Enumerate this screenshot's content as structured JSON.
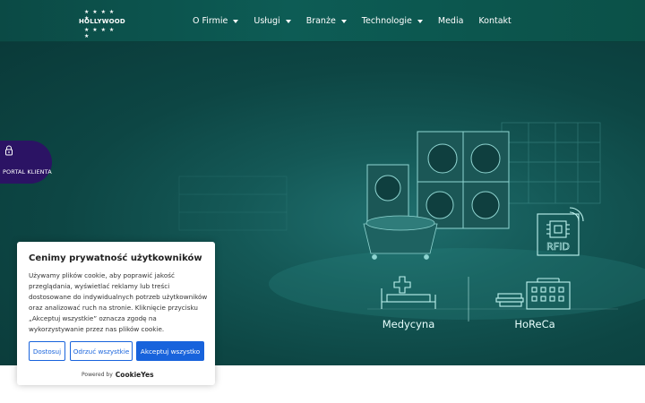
{
  "logo": {
    "text": "HOLLYWOOD",
    "stars": "★ ★ ★ ★ ★"
  },
  "nav": {
    "items": [
      {
        "label": "O Firmie",
        "dropdown": true
      },
      {
        "label": "Usługi",
        "dropdown": true
      },
      {
        "label": "Branże",
        "dropdown": true
      },
      {
        "label": "Technologie",
        "dropdown": true
      },
      {
        "label": "Media",
        "dropdown": false
      },
      {
        "label": "Kontakt",
        "dropdown": false
      }
    ]
  },
  "hero": {
    "rfid_label": "RFID",
    "medical_label": "Medycyna",
    "horeca_label": "HoReCa"
  },
  "portal": {
    "label": "PORTAL KLIENTA",
    "icon": "lock-icon"
  },
  "cookie": {
    "title": "Cenimy prywatność użytkowników",
    "body": "Używamy plików cookie, aby poprawić jakość przeglądania, wyświetlać reklamy lub treści dostosowane do indywidualnych potrzeb użytkowników oraz analizować ruch na stronie. Kliknięcie przycisku „Akceptuj wszystkie” oznacza zgodę na wykorzystywanie przez nas plików cookie.",
    "buttons": {
      "customize": "Dostosuj",
      "reject": "Odrzuć wszystkie",
      "accept": "Akceptuj wszystko"
    },
    "powered_by": "Powered by",
    "powered_brand": "CookieYes"
  },
  "colors": {
    "nav_bg": "#0d5c55",
    "hero_bg": "#145856",
    "accent": "#1863dc",
    "portal_bg": "#2b1364",
    "line_art": "#9fe8e3"
  }
}
